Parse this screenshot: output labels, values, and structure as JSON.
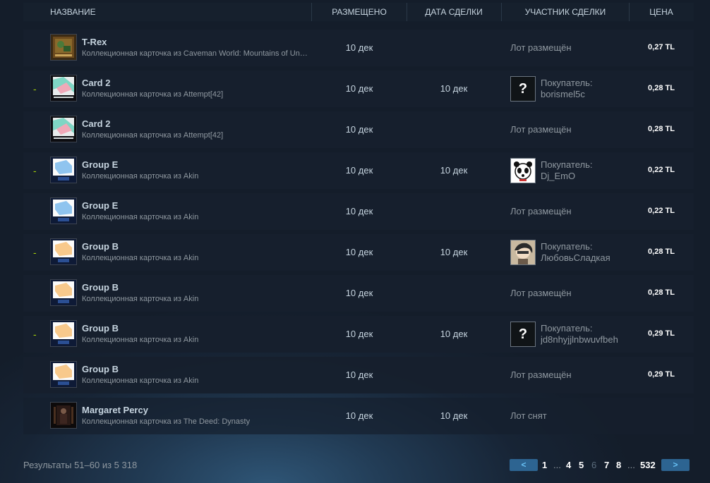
{
  "header": {
    "name": "НАЗВАНИЕ",
    "listed": "РАЗМЕЩЕНО",
    "acted": "ДАТА СДЕЛКИ",
    "party": "УЧАСТНИК СДЕЛКИ",
    "price": "ЦЕНА"
  },
  "rows": [
    {
      "dash": "",
      "name": "T-Rex",
      "game": "Коллекционная карточка из Caveman World: Mountains of Unga Boonga",
      "listed": "10 дек",
      "acted": "",
      "status": "Лот размещён",
      "buyer_label": "",
      "buyer_name": "",
      "price": "0,27 TL",
      "thumb": "trex"
    },
    {
      "dash": "-",
      "name": "Card 2",
      "game": "Коллекционная карточка из Attempt[42]",
      "listed": "10 дек",
      "acted": "10 дек",
      "status": "",
      "buyer_label": "Покупатель:",
      "buyer_name": "borismel5c",
      "avatar": "question",
      "price": "0,28 TL",
      "thumb": "attempt"
    },
    {
      "dash": "",
      "name": "Card 2",
      "game": "Коллекционная карточка из Attempt[42]",
      "listed": "10 дек",
      "acted": "",
      "status": "Лот размещён",
      "buyer_label": "",
      "buyer_name": "",
      "price": "0,28 TL",
      "thumb": "attempt"
    },
    {
      "dash": "-",
      "name": "Group E",
      "game": "Коллекционная карточка из Akin",
      "listed": "10 дек",
      "acted": "10 дек",
      "status": "",
      "buyer_label": "Покупатель:",
      "buyer_name": "Dj_EmO",
      "avatar": "panda",
      "price": "0,22 TL",
      "thumb": "akin-blue"
    },
    {
      "dash": "",
      "name": "Group E",
      "game": "Коллекционная карточка из Akin",
      "listed": "10 дек",
      "acted": "",
      "status": "Лот размещён",
      "buyer_label": "",
      "buyer_name": "",
      "price": "0,22 TL",
      "thumb": "akin-blue"
    },
    {
      "dash": "-",
      "name": "Group B",
      "game": "Коллекционная карточка из Akin",
      "listed": "10 дек",
      "acted": "10 дек",
      "status": "",
      "buyer_label": "Покупатель:",
      "buyer_name": "ЛюбовьСладкая",
      "avatar": "anime",
      "price": "0,28 TL",
      "thumb": "akin-orange"
    },
    {
      "dash": "",
      "name": "Group B",
      "game": "Коллекционная карточка из Akin",
      "listed": "10 дек",
      "acted": "",
      "status": "Лот размещён",
      "buyer_label": "",
      "buyer_name": "",
      "price": "0,28 TL",
      "thumb": "akin-orange"
    },
    {
      "dash": "-",
      "name": "Group B",
      "game": "Коллекционная карточка из Akin",
      "listed": "10 дек",
      "acted": "10 дек",
      "status": "",
      "buyer_label": "Покупатель:",
      "buyer_name": "jd8nhyjjlnbwuvfbeh",
      "avatar": "question",
      "price": "0,29 TL",
      "thumb": "akin-orange"
    },
    {
      "dash": "",
      "name": "Group B",
      "game": "Коллекционная карточка из Akin",
      "listed": "10 дек",
      "acted": "",
      "status": "Лот размещён",
      "buyer_label": "",
      "buyer_name": "",
      "price": "0,29 TL",
      "thumb": "akin-orange"
    },
    {
      "dash": "",
      "name": "Margaret Percy",
      "game": "Коллекционная карточка из The Deed: Dynasty",
      "listed": "10 дек",
      "acted": "10 дек",
      "status": "Лот снят",
      "buyer_label": "",
      "buyer_name": "",
      "price": "",
      "thumb": "deed"
    }
  ],
  "footer": {
    "results": "Результаты 51–60 из 5 318",
    "prev": "<",
    "next": ">",
    "pages": [
      "1",
      "...",
      "4",
      "5",
      "6",
      "7",
      "8",
      "...",
      "532"
    ],
    "current_page": "6"
  },
  "colors": {
    "accent": "#67c1f5",
    "dash": "#a4d007",
    "button_bg": "#2d6491"
  }
}
